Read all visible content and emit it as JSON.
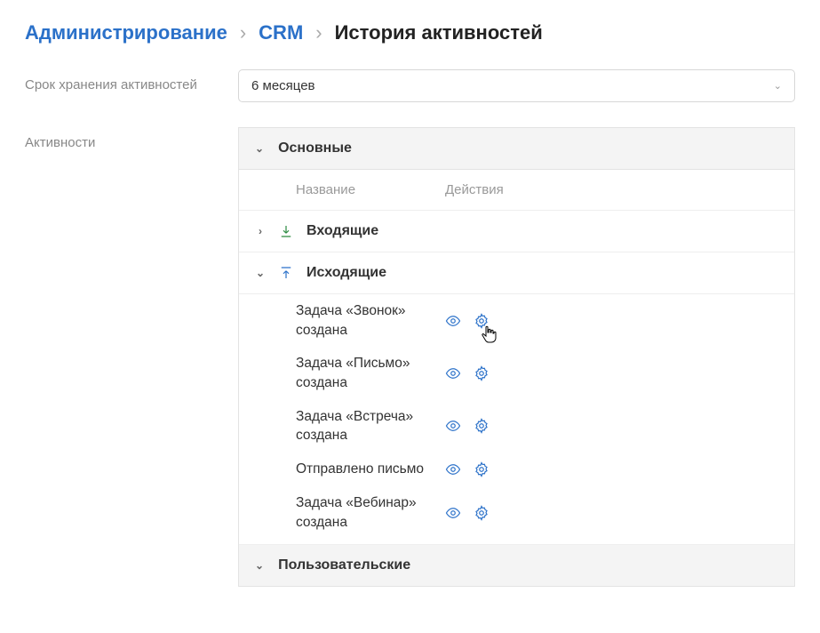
{
  "breadcrumb": {
    "admin": "Администрирование",
    "crm": "CRM",
    "current": "История активностей"
  },
  "labels": {
    "retention": "Срок хранения активностей",
    "activities": "Активности"
  },
  "retention": {
    "value": "6 месяцев"
  },
  "sections": {
    "main": "Основные",
    "user": "Пользовательские"
  },
  "columns": {
    "name": "Название",
    "actions": "Действия"
  },
  "groups": {
    "incoming": "Входящие",
    "outgoing": "Исходящие"
  },
  "items": [
    {
      "name": "Задача «Звонок» создана"
    },
    {
      "name": "Задача «Письмо» создана"
    },
    {
      "name": "Задача «Встреча» создана"
    },
    {
      "name": "Отправлено письмо"
    },
    {
      "name": "Задача «Вебинар» создана"
    }
  ]
}
